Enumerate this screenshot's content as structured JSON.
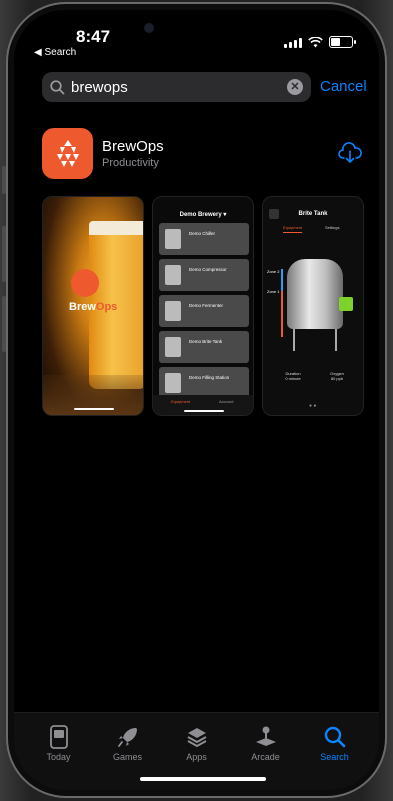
{
  "status": {
    "time": "8:47",
    "back_label": "◀ Search"
  },
  "search": {
    "query": "brewops",
    "cancel_label": "Cancel"
  },
  "app": {
    "name": "BrewOps",
    "category": "Productivity",
    "icon_color": "#EE5A2E",
    "action_icon": "cloud-download-icon"
  },
  "screenshots": {
    "shot1": {
      "logo_a": "Brew",
      "logo_b": "Ops"
    },
    "shot2": {
      "title": "Demo Brewery ▾",
      "items": [
        "Demo Chiller",
        "Demo Compressor",
        "Demo Fermenter",
        "Demo Brite Tank",
        "Demo Filling Station"
      ],
      "tabs": [
        "Equipment",
        "Account"
      ]
    },
    "shot3": {
      "title": "Brite Tank",
      "tabs": [
        "Equipment",
        "Settings"
      ],
      "zone2": "Zone 2",
      "zone1": "Zone 1",
      "stat1_label": "Duration",
      "stat1_value": "0 minute",
      "stat2_label": "Oxygen",
      "stat2_value": "80 ppb",
      "dots": "● ●"
    }
  },
  "tabbar": [
    {
      "label": "Today",
      "icon": "today-icon",
      "active": false
    },
    {
      "label": "Games",
      "icon": "rocket-icon",
      "active": false
    },
    {
      "label": "Apps",
      "icon": "stack-icon",
      "active": false
    },
    {
      "label": "Arcade",
      "icon": "joystick-icon",
      "active": false
    },
    {
      "label": "Search",
      "icon": "search-icon",
      "active": true
    }
  ],
  "colors": {
    "accent": "#0A84FF",
    "brand": "#EE5A2E"
  }
}
